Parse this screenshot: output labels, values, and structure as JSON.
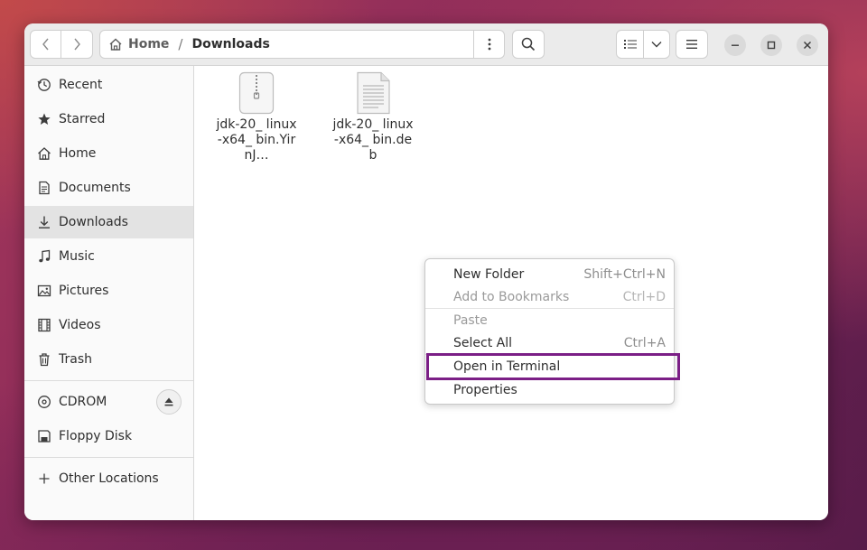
{
  "window": {
    "nav": {
      "back_icon": "chevron-left-icon",
      "forward_icon": "chevron-right-icon"
    },
    "pathbar": {
      "home_label": "Home",
      "separator": "/",
      "current": "Downloads"
    },
    "window_controls": {
      "minimize_icon": "minimize-icon",
      "maximize_icon": "maximize-icon",
      "close_icon": "close-icon"
    }
  },
  "sidebar": {
    "items": [
      {
        "label": "Recent",
        "icon": "clock-icon"
      },
      {
        "label": "Starred",
        "icon": "star-icon"
      },
      {
        "label": "Home",
        "icon": "home-icon"
      },
      {
        "label": "Documents",
        "icon": "document-icon"
      },
      {
        "label": "Downloads",
        "icon": "download-icon",
        "active": true
      },
      {
        "label": "Music",
        "icon": "music-note-icon"
      },
      {
        "label": "Pictures",
        "icon": "picture-icon"
      },
      {
        "label": "Videos",
        "icon": "film-icon"
      },
      {
        "label": "Trash",
        "icon": "trash-icon"
      }
    ],
    "devices": [
      {
        "label": "CDROM",
        "icon": "disc-icon",
        "eject_icon": "eject-icon"
      },
      {
        "label": "Floppy Disk",
        "icon": "floppy-icon"
      }
    ],
    "other": {
      "label": "Other Locations",
      "icon": "plus-icon"
    }
  },
  "files": [
    {
      "name": "jdk-20_ linux-x64_ bin.YirnJ…",
      "icon": "zip-archive-icon"
    },
    {
      "name": "jdk-20_ linux-x64_ bin.deb",
      "icon": "text-document-icon"
    }
  ],
  "context_menu": {
    "items": [
      {
        "label": "New Folder",
        "accel": "Shift+Ctrl+N",
        "enabled": true
      },
      {
        "label": "Add to Bookmarks",
        "accel": "Ctrl+D",
        "enabled": false
      },
      {
        "label": "Paste",
        "accel": "",
        "enabled": false
      },
      {
        "label": "Select All",
        "accel": "Ctrl+A",
        "enabled": true
      },
      {
        "label": "Open in Terminal",
        "accel": "",
        "enabled": true,
        "highlighted": true
      },
      {
        "label": "Properties",
        "accel": "",
        "enabled": true
      }
    ],
    "highlight_color": "#7b1f86"
  }
}
